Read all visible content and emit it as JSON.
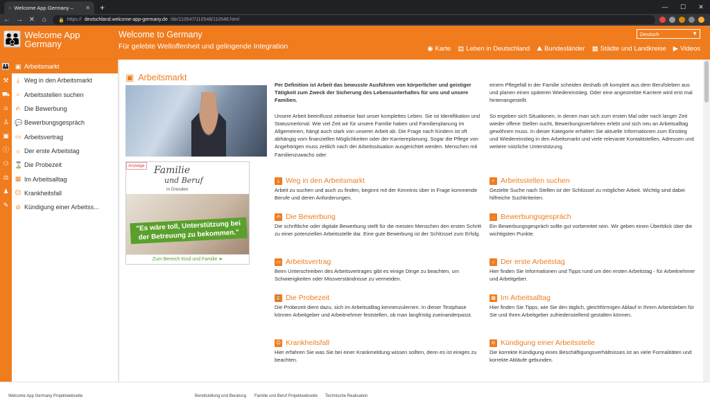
{
  "browser": {
    "tab_title": "Welcome App Germany –",
    "url_prefix": "https://",
    "url_host": "deutschland.welcome-app-germany.de",
    "url_path": "/de/110547/110548/110548.html"
  },
  "header": {
    "logo_line1": "Welcome App",
    "logo_line2": "Germany",
    "title": "Welcome to Germany",
    "subtitle": "Für gelebte Weltoffenheit und gelingende Integration",
    "language": "Deutsch",
    "nav": [
      {
        "label": "Karte"
      },
      {
        "label": "Leben in Deutschland"
      },
      {
        "label": "Bundesländer"
      },
      {
        "label": "Städte und Landkreise"
      },
      {
        "label": "Videos"
      }
    ]
  },
  "sidebar": {
    "items": [
      {
        "label": "Arbeitsmarkt",
        "icon": "briefcase-icon"
      },
      {
        "label": "Weg in den Arbeitsmarkt",
        "icon": "download-icon"
      },
      {
        "label": "Arbeitsstellen suchen",
        "icon": "search-icon"
      },
      {
        "label": "Die Bewerbung",
        "icon": "pen-icon"
      },
      {
        "label": "Bewerbungsgespräch",
        "icon": "speech-icon"
      },
      {
        "label": "Arbeitsvertrag",
        "icon": "contract-icon"
      },
      {
        "label": "Der erste Arbeitstag",
        "icon": "sun-icon"
      },
      {
        "label": "Die Probezeit",
        "icon": "hourglass-icon"
      },
      {
        "label": "Im Arbeitsalltag",
        "icon": "calendar-icon"
      },
      {
        "label": "Krankheitsfall",
        "icon": "sick-icon"
      },
      {
        "label": "Kündigung einer Arbeitss...",
        "icon": "ban-icon"
      }
    ]
  },
  "main": {
    "title": "Arbeitsmarkt",
    "intro_bold": "Per Definition ist Arbeit das bewusste Ausführen von körperlicher und geistiger Tätigkeit zum Zweck der Sicherung des Lebensunterhaltes für uns und unsere Familien.",
    "intro_p2": "Unsere Arbeit beeinflusst zeitweise fast unser komplettes Leben. Sie ist Identifikation und Statusmerkmal. Wie viel Zeit wir für unsere Familie haben und Familienplanung im Allgemeinen, hängt auch stark von unserer Arbeit ab. Die Frage nach Kindern ist oft abhängig vom finanziellen Möglichkeiten oder der Karriereplanung. Sogar die Pflege von Angehörigen muss zeitlich nach der Arbeitssituation ausgerichtet werden. Menschen mit Familienzuwachs oder",
    "intro_p3": "einem Pflegefall in der Familie scheiden deshalb oft komplett aus dem Berufsleben aus und planen einen späteren Wiedereinstieg. Oder eine angestrebte Karriere wird erst mal hintenangestellt.",
    "intro_p4": "So ergeben sich Situationen, in denen man sich zum ersten Mal oder nach langer Zeit wieder offene Stellen sucht, Bewerbungsverfahren erlebt und sich neu an Arbeitsalltag gewöhnen muss. In dieser Kategorie erhalten Sie aktuelle Informationen zum Einstieg und Wiedereinstieg in den Arbeitsmarkt und viele relevante Kontaktstellen, Adressen und weitere nützliche Unterstützung.",
    "sections": [
      {
        "title": "Weg in den Arbeitsmarkt",
        "text": "Arbeit zu suchen und auch zu finden, beginnt mit der Kenntnis über in Frage kommende Berufe und deren Anforderungen.",
        "icon": "download-icon"
      },
      {
        "title": "Arbeitsstellen suchen",
        "text": "Gezielte Suche nach Stellen ist der Schlüssel zu möglicher Arbeit. Wichtig sind dabei hilfreiche Suchkriterien.",
        "icon": "search-icon"
      },
      {
        "title": "Die Bewerbung",
        "text": "Die schriftliche oder digitale Bewerbung stellt für die meisten Menschen den ersten Schritt zu einer potenziellen Arbeitsstelle dar. Eine gute Bewerbung ist der Schlüssel zum Erfolg.",
        "icon": "pen-icon"
      },
      {
        "title": "Bewerbungsgespräch",
        "text": "Ein Bewerbungsgespräch sollte gut vorbereitet sein. Wir geben einen Überblick über die wichtigsten Punkte.",
        "icon": "speech-icon"
      },
      {
        "title": "Arbeitsvertrag",
        "text": "Beim Unterschreiben des Arbeitsvertrages gibt es einige Dinge zu beachten, um Schwierigkeiten oder Missverständnisse zu vermeiden.",
        "icon": "contract-icon"
      },
      {
        "title": "Der erste Arbeitstag",
        "text": "Hier finden Sie Informationen und Tipps rund um den ersten Arbeitstag - für Arbeitnehmer und Arbeitgeber.",
        "icon": "sun-icon"
      },
      {
        "title": "Die Probezeit",
        "text": "Die Probezeit dient dazu, sich im Arbeitsalltag kennenzulernen. In dieser Testphase können Arbeitgeber und Arbeitnehmer feststellen, ob man langfristig zueinanderpasst.",
        "icon": "hourglass-icon"
      },
      {
        "title": "Im Arbeitsalltag",
        "text": "Hier finden Sie Tipps, wie Sie den täglich, gleichförmigen Ablauf in Ihrem Arbeitsleben für Sie und Ihren Arbeitgeber zufriedenstellend gestalten können.",
        "icon": "calendar-icon"
      },
      {
        "title": "Krankheitsfall",
        "text": "Hier erfahren Sie was Sie bei einer Krankmeldung wissen sollten, denn es ist einiges zu beachten.",
        "icon": "sick-icon"
      },
      {
        "title": "Kündigung einer Arbeitsstelle",
        "text": "Die korrekte Kündigung eines Beschäftigungsverhältnisses ist an viele Formalitäten und korrekte Abläufe gebunden.",
        "icon": "ban-icon"
      }
    ]
  },
  "ad": {
    "tag": "Anzeige",
    "logo_line1": "Familie",
    "logo_line2": "und Beruf",
    "location": "in Dresden",
    "banner": "\"Es wäre toll, Unterstützung bei der Betreuung zu bekommen.\"",
    "link": "Zum Bereich Kind und Familie ➤"
  },
  "footer": {
    "links": [
      "Welcome App Germany Projektwebseite",
      "Bereitstellung und Beratung",
      "Familie und Beruf Projektwebseite",
      "Technische Realisation"
    ]
  }
}
